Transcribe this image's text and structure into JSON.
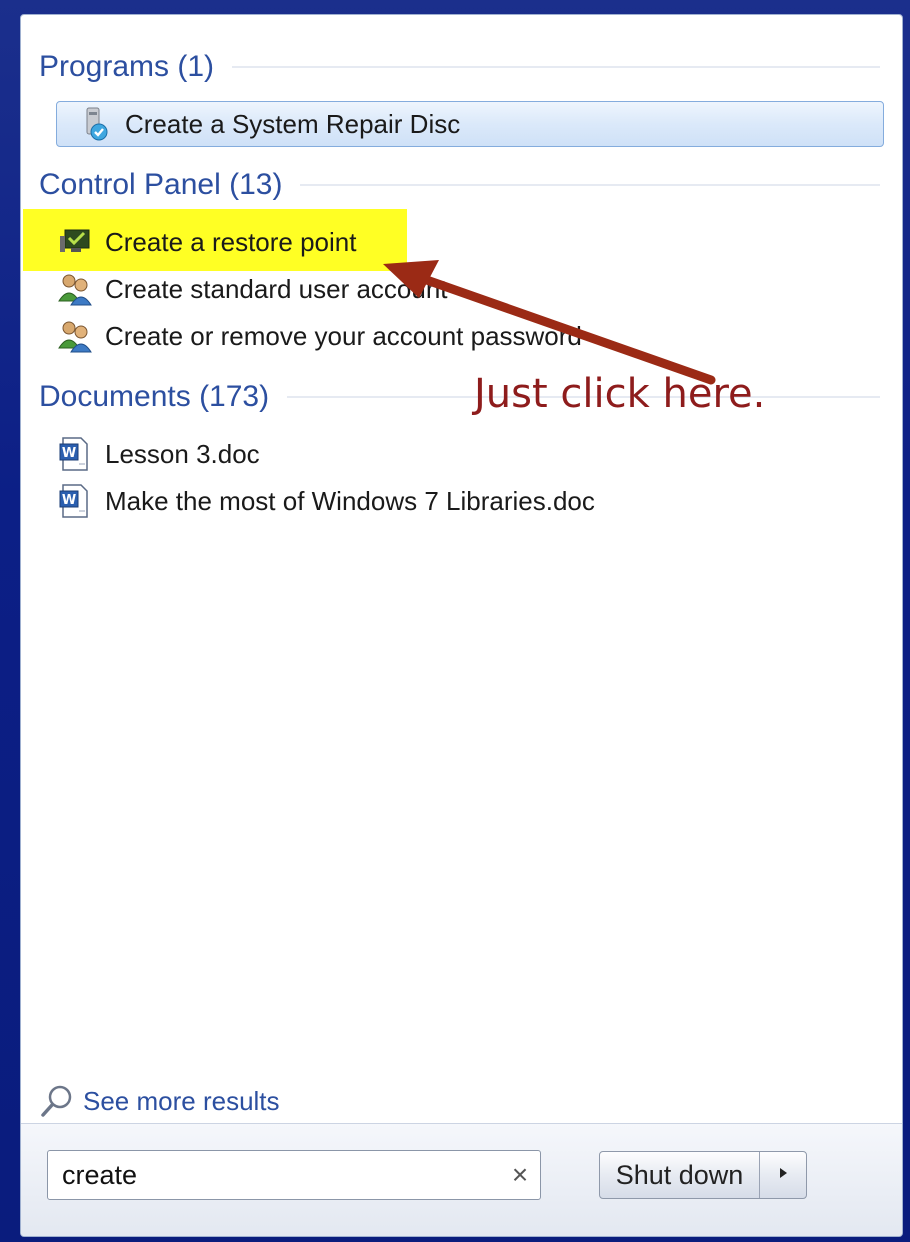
{
  "sections": {
    "programs": {
      "title": "Programs (1)"
    },
    "control_panel": {
      "title": "Control Panel (13)"
    },
    "documents": {
      "title": "Documents (173)"
    }
  },
  "programs_items": [
    {
      "label": "Create a System Repair Disc",
      "icon": "system-repair-disc-icon"
    }
  ],
  "control_panel_items": [
    {
      "label": "Create a restore point",
      "icon": "system-restore-icon"
    },
    {
      "label": "Create standard user account",
      "icon": "user-accounts-icon"
    },
    {
      "label": "Create or remove your account password",
      "icon": "user-accounts-icon"
    }
  ],
  "documents_items": [
    {
      "label": "Lesson 3.doc",
      "icon": "word-document-icon"
    },
    {
      "label": "Make the most of Windows 7 Libraries.doc",
      "icon": "word-document-icon"
    }
  ],
  "see_more": {
    "label": "See more results",
    "icon": "magnifier-icon"
  },
  "search": {
    "value": "create",
    "clear_icon": "close-icon"
  },
  "shutdown": {
    "label": "Shut down",
    "arrow_icon": "triangle-right-icon"
  },
  "annotation": {
    "text": "Just click here.",
    "color": "#8e1c1c"
  },
  "colors": {
    "section_header": "#2c4fa0",
    "highlight": "#ffff24",
    "background": "#0c1f86"
  }
}
